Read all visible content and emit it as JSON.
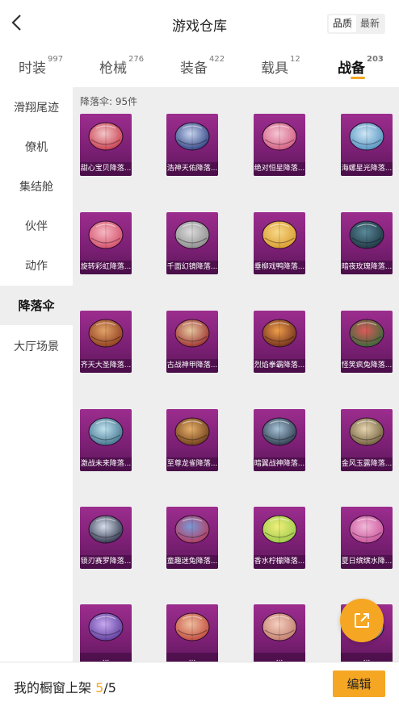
{
  "header": {
    "title": "游戏仓库",
    "sort_options": [
      "品质",
      "最新"
    ],
    "sort_active": 0
  },
  "tabs": [
    {
      "label": "时装",
      "count": "997"
    },
    {
      "label": "枪械",
      "count": "276"
    },
    {
      "label": "装备",
      "count": "422"
    },
    {
      "label": "载具",
      "count": "12"
    },
    {
      "label": "战备",
      "count": "203"
    }
  ],
  "active_tab": 4,
  "sidebar": {
    "items": [
      "滑翔尾迹",
      "僚机",
      "集结舱",
      "伙伴",
      "动作",
      "降落伞",
      "大厅场景"
    ],
    "active": 5
  },
  "content": {
    "count_label": "降落伞: 95件",
    "items": [
      {
        "name": "甜心宝贝降落...",
        "icon": "parachute-icon"
      },
      {
        "name": "浩神天佑降落...",
        "icon": "parachute-icon"
      },
      {
        "name": "绝对恒星降落...",
        "icon": "parachute-icon"
      },
      {
        "name": "海螺星光降落...",
        "icon": "parachute-icon"
      },
      {
        "name": "旋转彩虹降落...",
        "icon": "parachute-icon"
      },
      {
        "name": "千面幻镜降落...",
        "icon": "parachute-icon"
      },
      {
        "name": "垂柳戏鸭降落...",
        "icon": "parachute-icon"
      },
      {
        "name": "暗夜玫瑰降落...",
        "icon": "parachute-icon"
      },
      {
        "name": "齐天大圣降落...",
        "icon": "parachute-icon"
      },
      {
        "name": "古战神甲降落...",
        "icon": "parachute-icon"
      },
      {
        "name": "烈焰拳霸降落...",
        "icon": "parachute-icon"
      },
      {
        "name": "怪笑疯兔降落...",
        "icon": "parachute-icon"
      },
      {
        "name": "激战未来降落...",
        "icon": "parachute-icon"
      },
      {
        "name": "至尊龙雀降落...",
        "icon": "parachute-icon"
      },
      {
        "name": "暗翼战神降落...",
        "icon": "parachute-icon"
      },
      {
        "name": "金风玉露降落...",
        "icon": "parachute-icon"
      },
      {
        "name": "锁刃赛罗降落...",
        "icon": "parachute-icon"
      },
      {
        "name": "童趣迷兔降落...",
        "icon": "parachute-icon"
      },
      {
        "name": "香水柠檬降落...",
        "icon": "parachute-icon"
      },
      {
        "name": "夏日缤缤水降...",
        "icon": "parachute-icon"
      },
      {
        "name": "...",
        "icon": "parachute-icon"
      },
      {
        "name": "...",
        "icon": "parachute-icon"
      },
      {
        "name": "...",
        "icon": "parachute-icon"
      },
      {
        "name": "...",
        "icon": "parachute-icon"
      }
    ]
  },
  "fab_icon": "share-out-icon",
  "bottom": {
    "shelf_label": "我的橱窗上架",
    "shelf_current": "5",
    "shelf_sep": "/",
    "shelf_total": "5",
    "edit_label": "编辑"
  },
  "colors": {
    "accent": "#f5a623",
    "card_purple": "#8a2783",
    "panel_bg": "#eeeeee"
  }
}
